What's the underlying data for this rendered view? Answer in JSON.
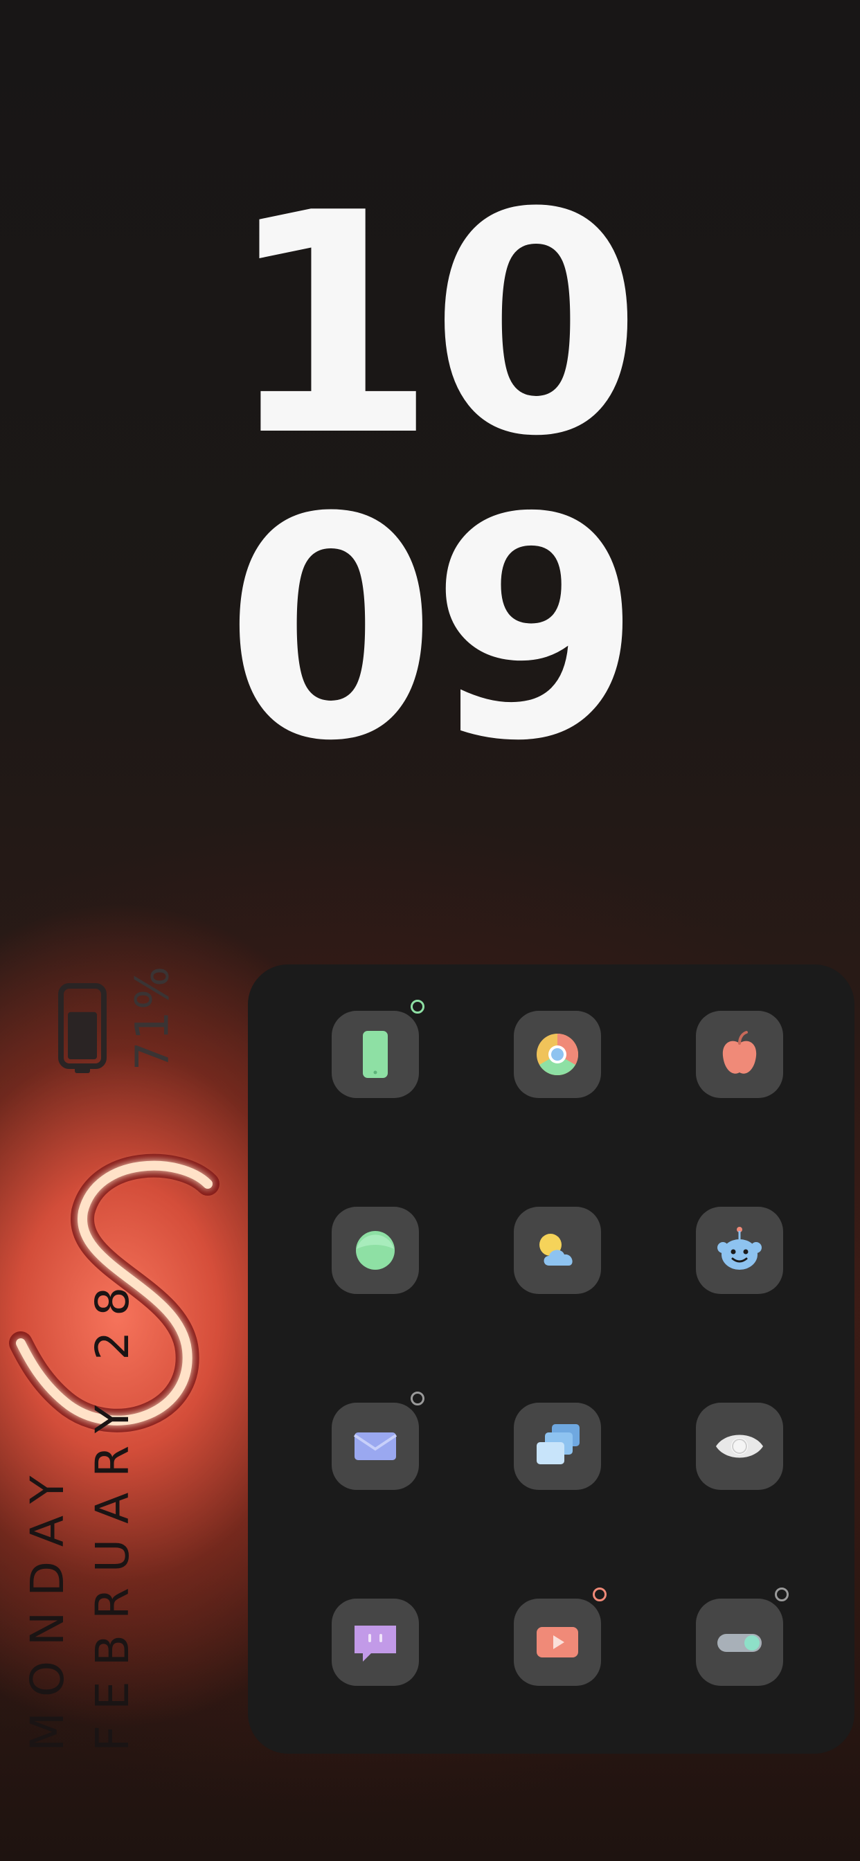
{
  "clock": {
    "hour": "10",
    "minute": "09"
  },
  "battery": {
    "percent_label": "71%",
    "level": 0.71,
    "icon": "battery-icon"
  },
  "date": {
    "day": "MONDAY",
    "month_day": "FEBRUARY 28"
  },
  "wallpaper": {
    "accent": "#e65a45",
    "motif": "neon-dollar-sign"
  },
  "apps": [
    {
      "icon": "phone-icon",
      "color": "#8ee0a4",
      "dot": "#8ee0a4"
    },
    {
      "icon": "chrome-icon",
      "color": "#f0c35a"
    },
    {
      "icon": "apple-icon",
      "color": "#f08a78"
    },
    {
      "icon": "green-circle-icon",
      "color": "#8ee0a4"
    },
    {
      "icon": "weather-icon",
      "color": "#8ec3f0"
    },
    {
      "icon": "reddit-icon",
      "color": "#8ec3f0"
    },
    {
      "icon": "mail-icon",
      "color": "#9aa8f0",
      "dot": "#9a9a9a"
    },
    {
      "icon": "cards-icon",
      "color": "#8ec3f0"
    },
    {
      "icon": "eye-icon",
      "color": "#e8e8e8"
    },
    {
      "icon": "chat-icon",
      "color": "#c29ae8"
    },
    {
      "icon": "play-icon",
      "color": "#f08a78",
      "dot": "#f08a78"
    },
    {
      "icon": "toggle-icon",
      "color": "#8ee0c8",
      "dot": "#9a9a9a"
    }
  ]
}
